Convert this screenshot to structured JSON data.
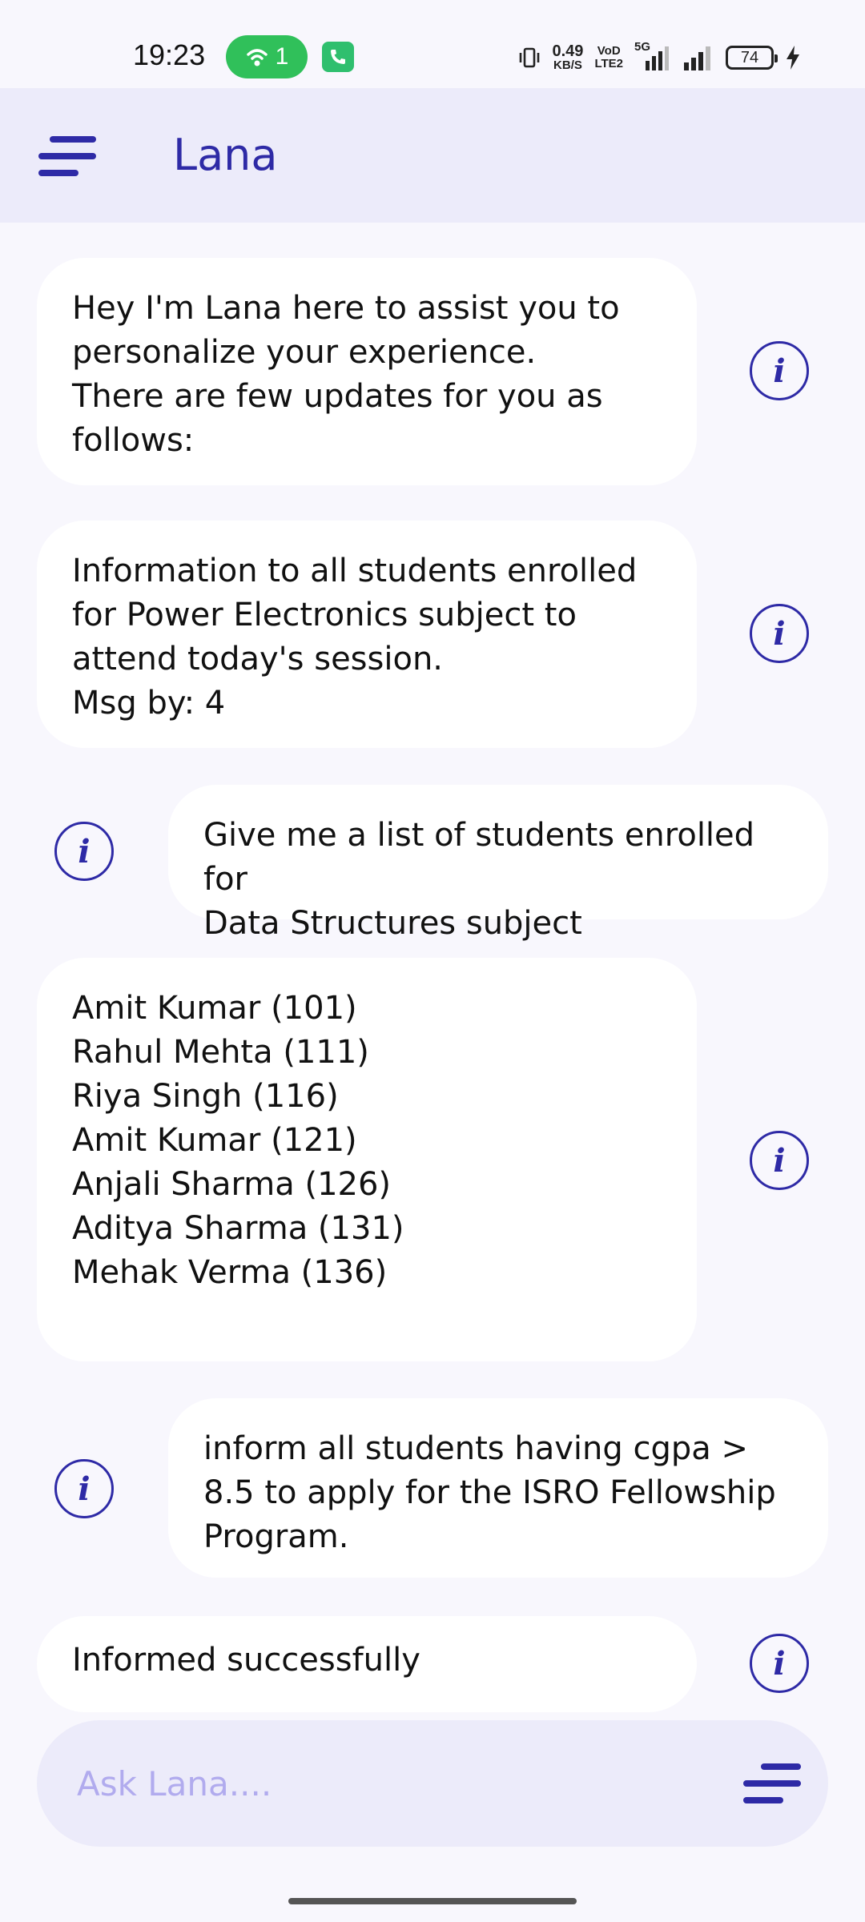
{
  "status_bar": {
    "time": "19:23",
    "hotspot_count": "1",
    "net_speed_value": "0.49",
    "net_speed_unit": "KB/S",
    "volte_top": "VoD",
    "volte_bottom": "LTE2",
    "net_type": "5G",
    "battery": "74"
  },
  "app_bar": {
    "title": "Lana"
  },
  "messages": [
    {
      "sender": "bot",
      "text": "Hey I'm Lana here to assist you to\npersonalize your experience.\nThere are few updates for you as\nfollows:"
    },
    {
      "sender": "bot",
      "text": "Information to all students enrolled\nfor Power Electronics subject to\nattend today's session.\nMsg by: 4"
    },
    {
      "sender": "user",
      "text": "Give me a list of students enrolled for\nData Structures subject"
    },
    {
      "sender": "bot",
      "text": "Amit Kumar (101)\nRahul Mehta (111)\nRiya Singh (116)\nAmit Kumar (121)\nAnjali Sharma (126)\nAditya Sharma (131)\nMehak Verma (136)"
    },
    {
      "sender": "user",
      "text": "inform all students having cgpa >\n8.5 to apply for the ISRO Fellowship\nProgram."
    },
    {
      "sender": "bot",
      "text": "Informed successfully"
    }
  ],
  "info_icon_glyph": "i",
  "input": {
    "placeholder": "Ask Lana....",
    "value": ""
  },
  "colors": {
    "accent": "#2e2aa6",
    "appbar_bg": "#ecebfa",
    "page_bg": "#f8f7fd",
    "bubble_bg": "#ffffff",
    "placeholder": "#b1abee"
  }
}
